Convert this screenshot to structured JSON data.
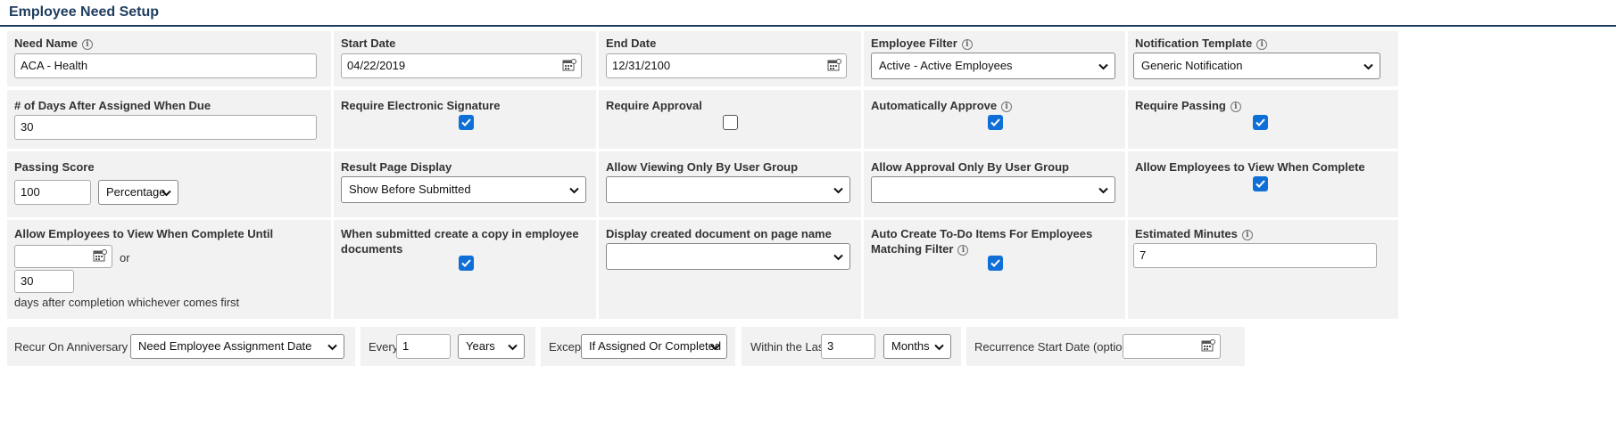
{
  "page_title": "Employee Need Setup",
  "fields": {
    "need_name": {
      "label": "Need Name",
      "value": "ACA - Health"
    },
    "start_date": {
      "label": "Start Date",
      "value": "04/22/2019"
    },
    "end_date": {
      "label": "End Date",
      "value": "12/31/2100"
    },
    "employee_filter": {
      "label": "Employee Filter",
      "value": "Active - Active Employees"
    },
    "notification_template": {
      "label": "Notification Template",
      "value": "Generic Notification"
    },
    "days_due": {
      "label": "# of Days After Assigned When Due",
      "value": "30"
    },
    "require_signature": {
      "label": "Require Electronic Signature",
      "checked": true
    },
    "require_approval": {
      "label": "Require Approval",
      "checked": false
    },
    "auto_approve": {
      "label": "Automatically Approve",
      "checked": true
    },
    "require_passing": {
      "label": "Require Passing",
      "checked": true
    },
    "passing_score": {
      "label": "Passing Score",
      "value": "100",
      "type": "Percentage"
    },
    "result_page_display": {
      "label": "Result Page Display",
      "value": "Show Before Submitted"
    },
    "viewing_group": {
      "label": "Allow Viewing Only By User Group",
      "value": ""
    },
    "approval_group": {
      "label": "Allow Approval Only By User Group",
      "value": ""
    },
    "view_when_complete": {
      "label": "Allow Employees to View When Complete",
      "checked": true
    },
    "view_until": {
      "label": "Allow Employees to View When Complete Until",
      "date": "",
      "or_text": "or",
      "days": "30",
      "suffix": "days after completion whichever comes first"
    },
    "copy_to_documents": {
      "label": "When submitted create a copy in employee documents",
      "checked": true
    },
    "display_page_name": {
      "label": "Display created document on page name",
      "value": ""
    },
    "auto_todo": {
      "label": "Auto Create To-Do Items For Employees Matching Filter",
      "checked": true
    },
    "estimated_minutes": {
      "label": "Estimated Minutes",
      "value": "7"
    }
  },
  "recurrence": {
    "anniversary_label": "Recur On Anniversary Of",
    "anniversary_value": "Need Employee Assignment Date",
    "every_label": "Every",
    "every_value": "1",
    "every_unit": "Years",
    "except_label": "Except",
    "except_value": "If Assigned Or Completed",
    "within_label": "Within the Last",
    "within_value": "3",
    "within_unit": "Months",
    "start_label": "Recurrence Start Date (optional)",
    "start_value": ""
  }
}
